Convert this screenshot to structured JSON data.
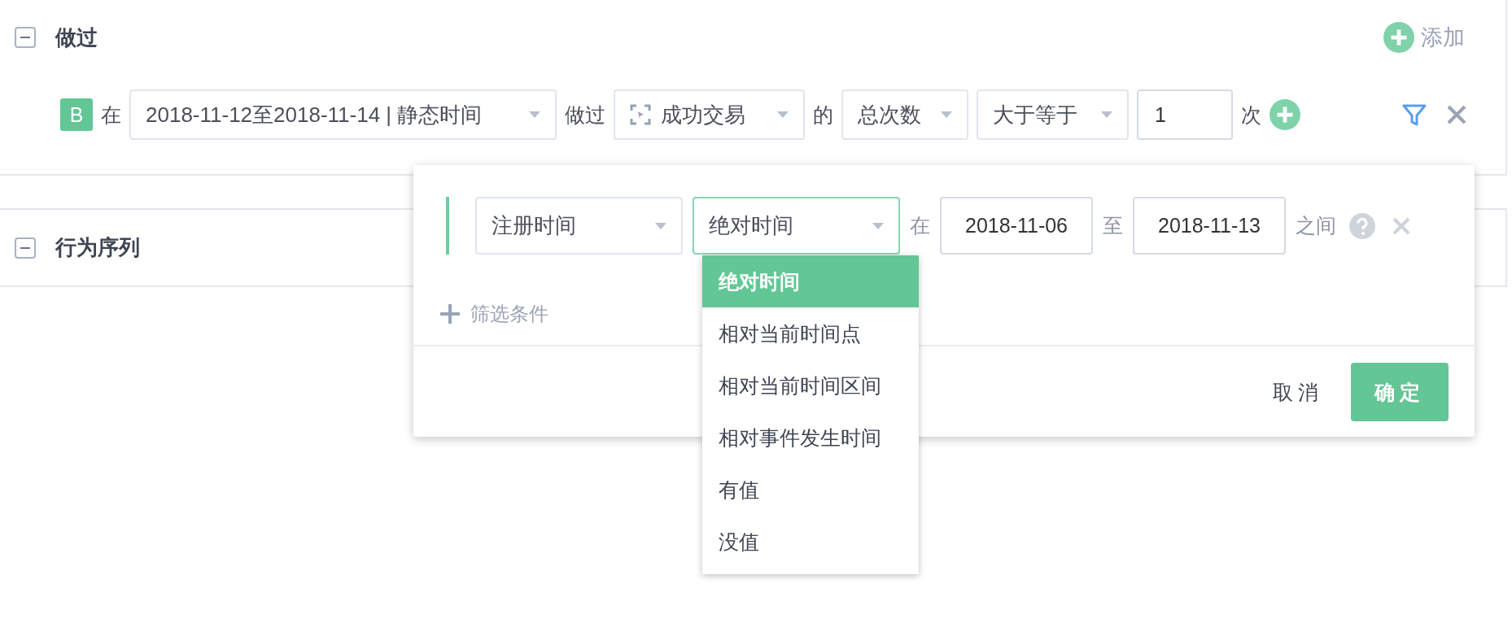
{
  "sections": [
    {
      "title": "做过",
      "expanded": true
    },
    {
      "title": "行为序列",
      "expanded": true
    }
  ],
  "add_button": "添加",
  "condition": {
    "badge": "B",
    "prefix": "在",
    "time_select": "2018-11-12至2018-11-14 | 静态时间",
    "did": "做过",
    "event_select": "成功交易",
    "of": "的",
    "metric_select": "总次数",
    "operator_select": "大于等于",
    "count_value": "1",
    "unit": "次"
  },
  "filter_popup": {
    "property_select": "注册时间",
    "time_type_select": {
      "value": "绝对时间",
      "open": true
    },
    "in": "在",
    "start_date": "2018-11-06",
    "to": "至",
    "end_date": "2018-11-13",
    "between": "之间",
    "add_filter": "筛选条件",
    "cancel": "取消",
    "confirm": "确定"
  },
  "time_type_options": [
    {
      "label": "绝对时间",
      "selected": true
    },
    {
      "label": "相对当前时间点",
      "selected": false
    },
    {
      "label": "相对当前时间区间",
      "selected": false
    },
    {
      "label": "相对事件发生时间",
      "selected": false
    },
    {
      "label": "有值",
      "selected": false
    },
    {
      "label": "没值",
      "selected": false
    }
  ]
}
